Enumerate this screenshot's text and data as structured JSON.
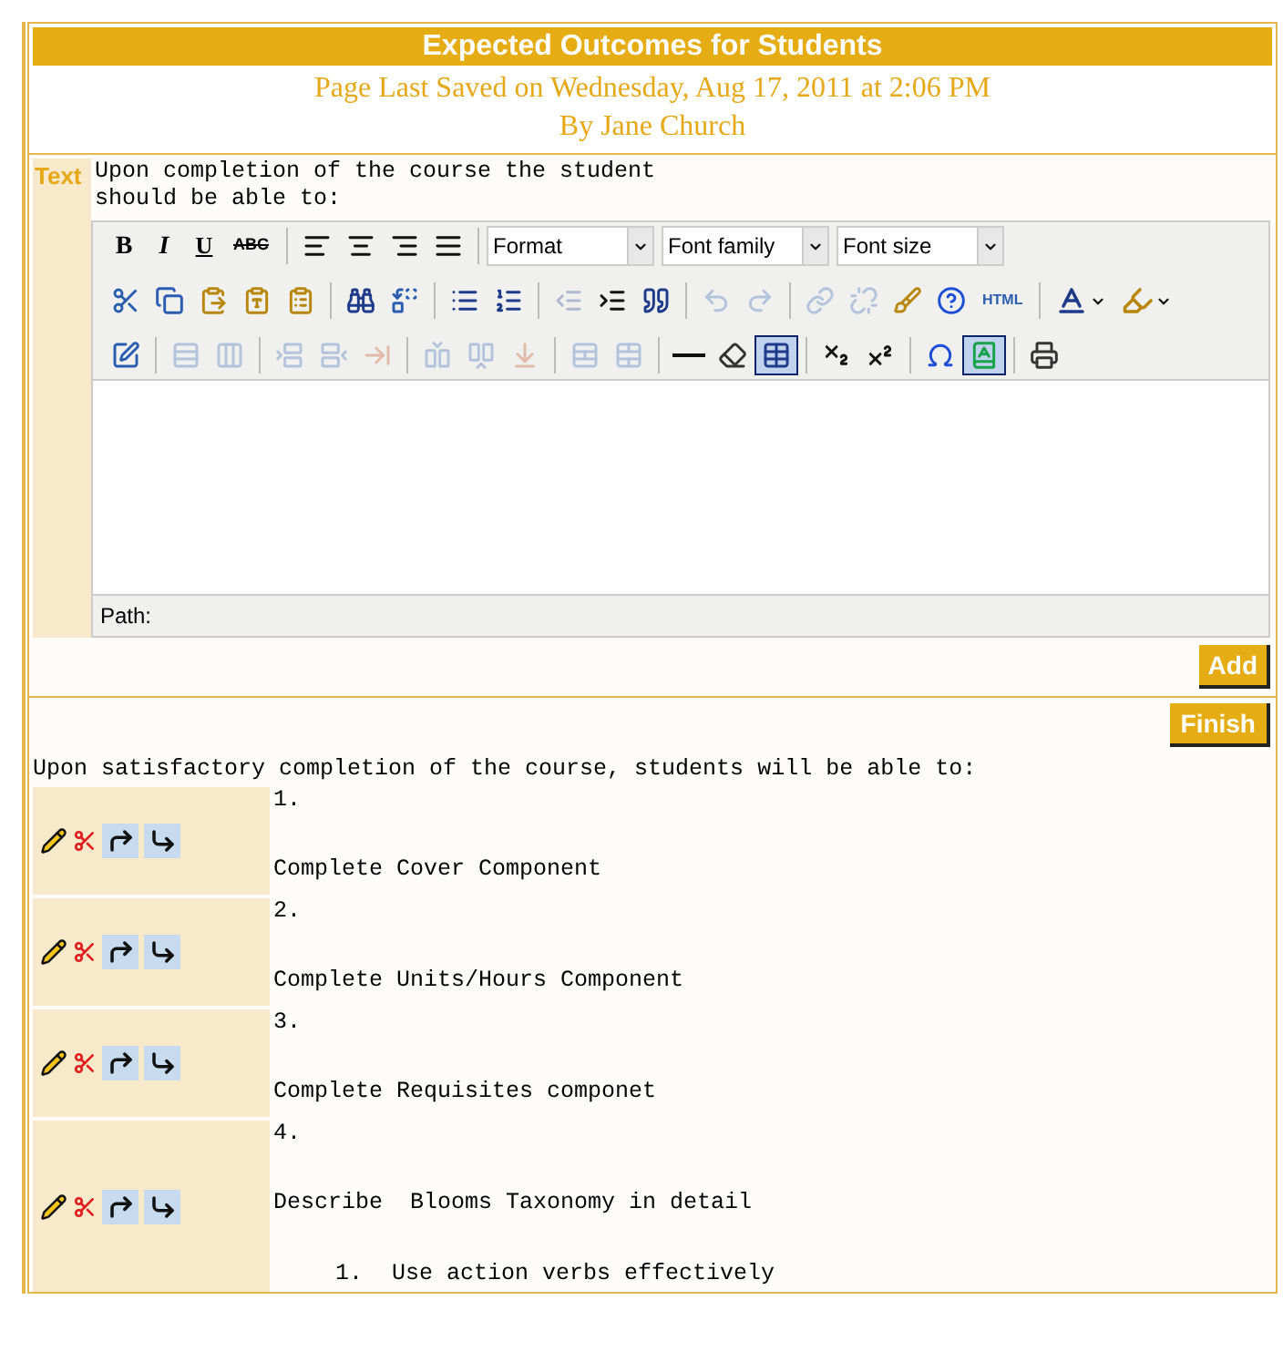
{
  "header": {
    "title": "Expected Outcomes for Students",
    "saved": "Page Last Saved on Wednesday, Aug 17, 2011 at 2:06 PM",
    "author": "By Jane Church"
  },
  "editor": {
    "label": "Text",
    "content": [
      "Upon completion of the course the student",
      "should be able to:"
    ],
    "toolbar": [
      {
        "groups": [
          {
            "items": [
              {
                "kind": "text",
                "label": "B",
                "disabled": false
              },
              {
                "kind": "text",
                "label": "I",
                "disabled": false
              },
              {
                "kind": "text",
                "label": "U",
                "disabled": false
              },
              {
                "kind": "text",
                "label": "ABC",
                "disabled": false
              }
            ]
          },
          {
            "items": [
              {
                "kind": "icon",
                "disabled": false
              },
              {
                "kind": "icon",
                "disabled": false
              },
              {
                "kind": "icon",
                "disabled": false
              },
              {
                "kind": "icon",
                "disabled": false
              }
            ]
          },
          {
            "items": [
              {
                "kind": "select",
                "label": "Format"
              },
              {
                "kind": "select",
                "label": "Font family"
              },
              {
                "kind": "select",
                "label": "Font size"
              }
            ]
          }
        ]
      },
      {
        "groups": [
          {
            "items": [
              {
                "kind": "icon",
                "disabled": false
              },
              {
                "kind": "icon",
                "disabled": false
              },
              {
                "kind": "icon",
                "disabled": false
              },
              {
                "kind": "icon",
                "disabled": false
              },
              {
                "kind": "icon",
                "disabled": false
              }
            ]
          },
          {
            "items": [
              {
                "kind": "icon",
                "disabled": false
              },
              {
                "kind": "icon",
                "disabled": false
              }
            ]
          },
          {
            "items": [
              {
                "kind": "icon",
                "disabled": false
              },
              {
                "kind": "icon",
                "disabled": false
              }
            ]
          },
          {
            "items": [
              {
                "kind": "icon",
                "disabled": true
              },
              {
                "kind": "icon",
                "disabled": false
              },
              {
                "kind": "icon",
                "disabled": false
              }
            ]
          },
          {
            "items": [
              {
                "kind": "icon",
                "disabled": true
              },
              {
                "kind": "icon",
                "disabled": true
              }
            ]
          },
          {
            "items": [
              {
                "kind": "icon",
                "disabled": true
              },
              {
                "kind": "icon",
                "disabled": true
              },
              {
                "kind": "icon",
                "disabled": false
              },
              {
                "kind": "icon",
                "disabled": false
              },
              {
                "kind": "text",
                "label": "HTML",
                "disabled": false
              }
            ]
          },
          {
            "items": [
              {
                "kind": "split",
                "disabled": false
              },
              {
                "kind": "split",
                "disabled": false
              }
            ]
          }
        ]
      },
      {
        "groups": [
          {
            "items": [
              {
                "kind": "icon",
                "disabled": false,
                "selected": false
              }
            ]
          },
          {
            "items": [
              {
                "kind": "icon",
                "disabled": true,
                "selected": false
              },
              {
                "kind": "icon",
                "disabled": true,
                "selected": false
              }
            ]
          },
          {
            "items": [
              {
                "kind": "icon",
                "disabled": true,
                "selected": false
              },
              {
                "kind": "icon",
                "disabled": true,
                "selected": false
              },
              {
                "kind": "icon",
                "disabled": true,
                "selected": false
              }
            ]
          },
          {
            "items": [
              {
                "kind": "icon",
                "disabled": true,
                "selected": false
              },
              {
                "kind": "icon",
                "disabled": true,
                "selected": false
              },
              {
                "kind": "icon",
                "disabled": true,
                "selected": false
              }
            ]
          },
          {
            "items": [
              {
                "kind": "icon",
                "disabled": true,
                "selected": false
              },
              {
                "kind": "icon",
                "disabled": true,
                "selected": false
              }
            ]
          },
          {
            "items": [
              {
                "kind": "icon",
                "disabled": false,
                "selected": false
              },
              {
                "kind": "icon",
                "disabled": false,
                "selected": false
              },
              {
                "kind": "icon",
                "disabled": false,
                "selected": true
              }
            ]
          },
          {
            "items": [
              {
                "kind": "icon",
                "disabled": false,
                "selected": false
              },
              {
                "kind": "icon",
                "disabled": false,
                "selected": false
              }
            ]
          },
          {
            "items": [
              {
                "kind": "icon",
                "disabled": false,
                "selected": false
              },
              {
                "kind": "icon",
                "disabled": false,
                "selected": true
              }
            ]
          },
          {
            "items": [
              {
                "kind": "icon",
                "disabled": false,
                "selected": false
              }
            ]
          }
        ]
      }
    ],
    "path_label": "Path:"
  },
  "add_button": "Add",
  "finish_button": "Finish",
  "intro": "Upon satisfactory completion of the course, students will be able to:",
  "outcomes": [
    {
      "number": "1.",
      "text": "Complete Cover Component"
    },
    {
      "number": "2.",
      "text": "Complete Units/Hours Component"
    },
    {
      "number": "3.",
      "text": "Complete Requisites componet"
    },
    {
      "number": "4.",
      "text": "Describe  Blooms Taxonomy in detail",
      "children": [
        {
          "number": "1.",
          "text": "Use action verbs effectively"
        }
      ]
    }
  ]
}
